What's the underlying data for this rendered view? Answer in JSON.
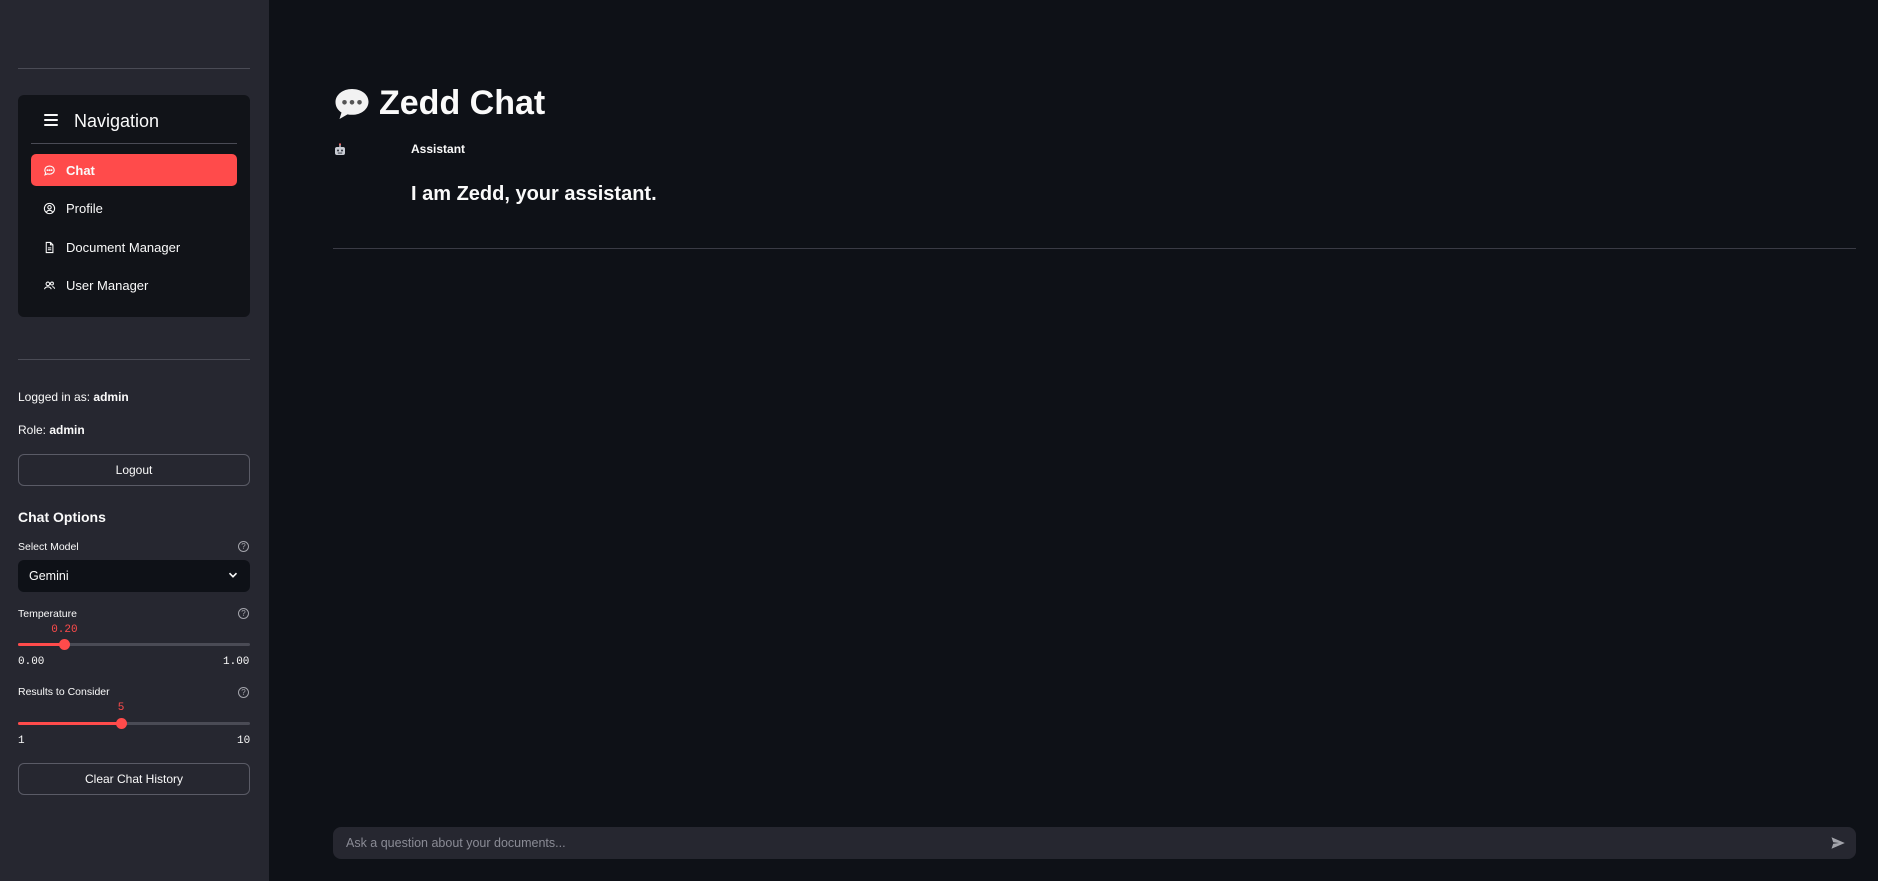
{
  "sidebar": {
    "nav": {
      "title": "Navigation",
      "items": [
        {
          "label": "Chat",
          "icon": "chat-bubble-icon",
          "active": true
        },
        {
          "label": "Profile",
          "icon": "user-circle-icon",
          "active": false
        },
        {
          "label": "Document Manager",
          "icon": "document-icon",
          "active": false
        },
        {
          "label": "User Manager",
          "icon": "users-icon",
          "active": false
        }
      ]
    },
    "logged_in_prefix": "Logged in as:",
    "logged_in_user": "admin",
    "role_prefix": "Role:",
    "role_value": "admin",
    "logout_label": "Logout",
    "chat_options": {
      "title": "Chat Options",
      "model_label": "Select Model",
      "model_value": "Gemini",
      "temperature": {
        "label": "Temperature",
        "value": "0.20",
        "min": "0.00",
        "max": "1.00",
        "fraction": 0.2
      },
      "results": {
        "label": "Results to Consider",
        "value": "5",
        "min": "1",
        "max": "10",
        "fraction": 0.444
      },
      "help_symbol": "?"
    },
    "clear_label": "Clear Chat History"
  },
  "main": {
    "title": "Zedd Chat",
    "message": {
      "role": "Assistant",
      "text": "I am Zedd, your assistant."
    },
    "input_placeholder": "Ask a question about your documents..."
  },
  "colors": {
    "accent": "#ff4b4b",
    "background": "#0e1117",
    "sidebar": "#262730"
  }
}
